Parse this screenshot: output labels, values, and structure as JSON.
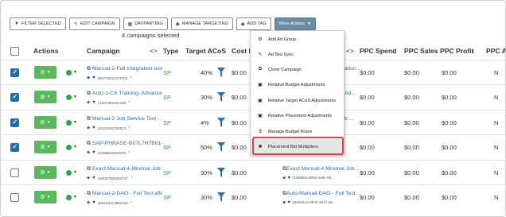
{
  "toolbar": {
    "filter_selected": "FILTER SELECTED",
    "edit_campaign": "EDIT CAMPAIGN",
    "dayparting": "DAYPARTING",
    "manage_targeting": "MANAGE TARGETING",
    "add_tag": "ADD TAG",
    "more_actions": "More Actions"
  },
  "selected_count": "4 campaigns selected",
  "headers": {
    "actions": "Actions",
    "campaign": "Campaign",
    "campaign_sort": "<>",
    "type": "Type",
    "target_acos": "Target ACoS",
    "cost_p": "Cost P",
    "adgroup_sort": "<>",
    "ppc_spend": "PPC Spend",
    "ppc_sales": "PPC Sales",
    "ppc_profit": "PPC Profit",
    "ppc_a": "PPC A"
  },
  "menu": [
    {
      "icon": "gear-icon",
      "label": "Add Ad Group"
    },
    {
      "icon": "pencil-icon",
      "label": "Ad Sku Sync"
    },
    {
      "icon": "copy-icon",
      "label": "Clone Campaign"
    },
    {
      "icon": "calculator-icon",
      "label": "Relative Budget Adjustments"
    },
    {
      "icon": "calculator-icon",
      "label": "Relative Target ACoS Adjustments"
    },
    {
      "icon": "calculator-icon",
      "label": "Relative Placement Adjustments"
    },
    {
      "icon": "dollar-icon",
      "label": "Manage Budget Rules"
    },
    {
      "icon": "asterisk-icon",
      "label": "Placement Bid Multipliers"
    }
  ],
  "rows": [
    {
      "checked": true,
      "campaign": "Manual-2-Full Integration test...",
      "id": "363710411371701",
      "type": "SP",
      "target_acos": "40%",
      "cost": "$0.00",
      "adgroup": "ation ...",
      "adgroup_id": "",
      "spend": "$0.00",
      "sales": "$0.00",
      "profit": "$0.00",
      "last": "N"
    },
    {
      "checked": true,
      "campaign": "Auto-1-CS Training- Advanced",
      "id": "71847051037490",
      "type": "SP",
      "target_acos": "30%",
      "cost": "$0.00",
      "adgroup": "Ad...",
      "adgroup_id": "",
      "spend": "$0.00",
      "sales": "$0.00",
      "profit": "$0.00",
      "last": "N"
    },
    {
      "checked": true,
      "campaign": "Manual-2-Job Service Test - ...",
      "id": "10324292783571",
      "type": "SP",
      "target_acos": "4%",
      "cost": "$0.00",
      "adgroup": "b ...",
      "adgroup_id": "",
      "spend": "$0.00",
      "sales": "$0.00",
      "profit": "$0.00",
      "last": "N"
    },
    {
      "checked": true,
      "campaign": "SAP-PHRASE-B07L7H7B61-7...",
      "id": "11098829250379",
      "type": "SP",
      "target_acos": "50%",
      "cost": "$0.00",
      "adgroup": "",
      "adgroup_id": "",
      "spend": "$0.00",
      "sales": "$0.00",
      "profit": "$0.00",
      "last": "N"
    },
    {
      "checked": false,
      "campaign": "Exact Manual-4-Minimal Job ...",
      "id": "169027806354747",
      "type": "SP",
      "target_acos": "30%",
      "cost": "$0.00",
      "adgroup": "Exact Manual-4-Minimal Job ...",
      "adgroup_id": "ef34850a-b80d-4e6c-80...",
      "spend": "$0.00",
      "sales": "$0.00",
      "profit": "$0.00",
      "last": "N"
    },
    {
      "checked": false,
      "campaign": "Manual-2-DAO - Full Test afte...",
      "id": "129183410882160",
      "type": "SP",
      "target_acos": "30%",
      "cost": "$0.00",
      "adgroup": "Auto-Manual-DAO - Full Test ...",
      "adgroup_id": "2a53e612-6b43-4b47-96...",
      "spend": "$0.00",
      "sales": "$0.00",
      "profit": "$0.00",
      "last": "N"
    }
  ]
}
